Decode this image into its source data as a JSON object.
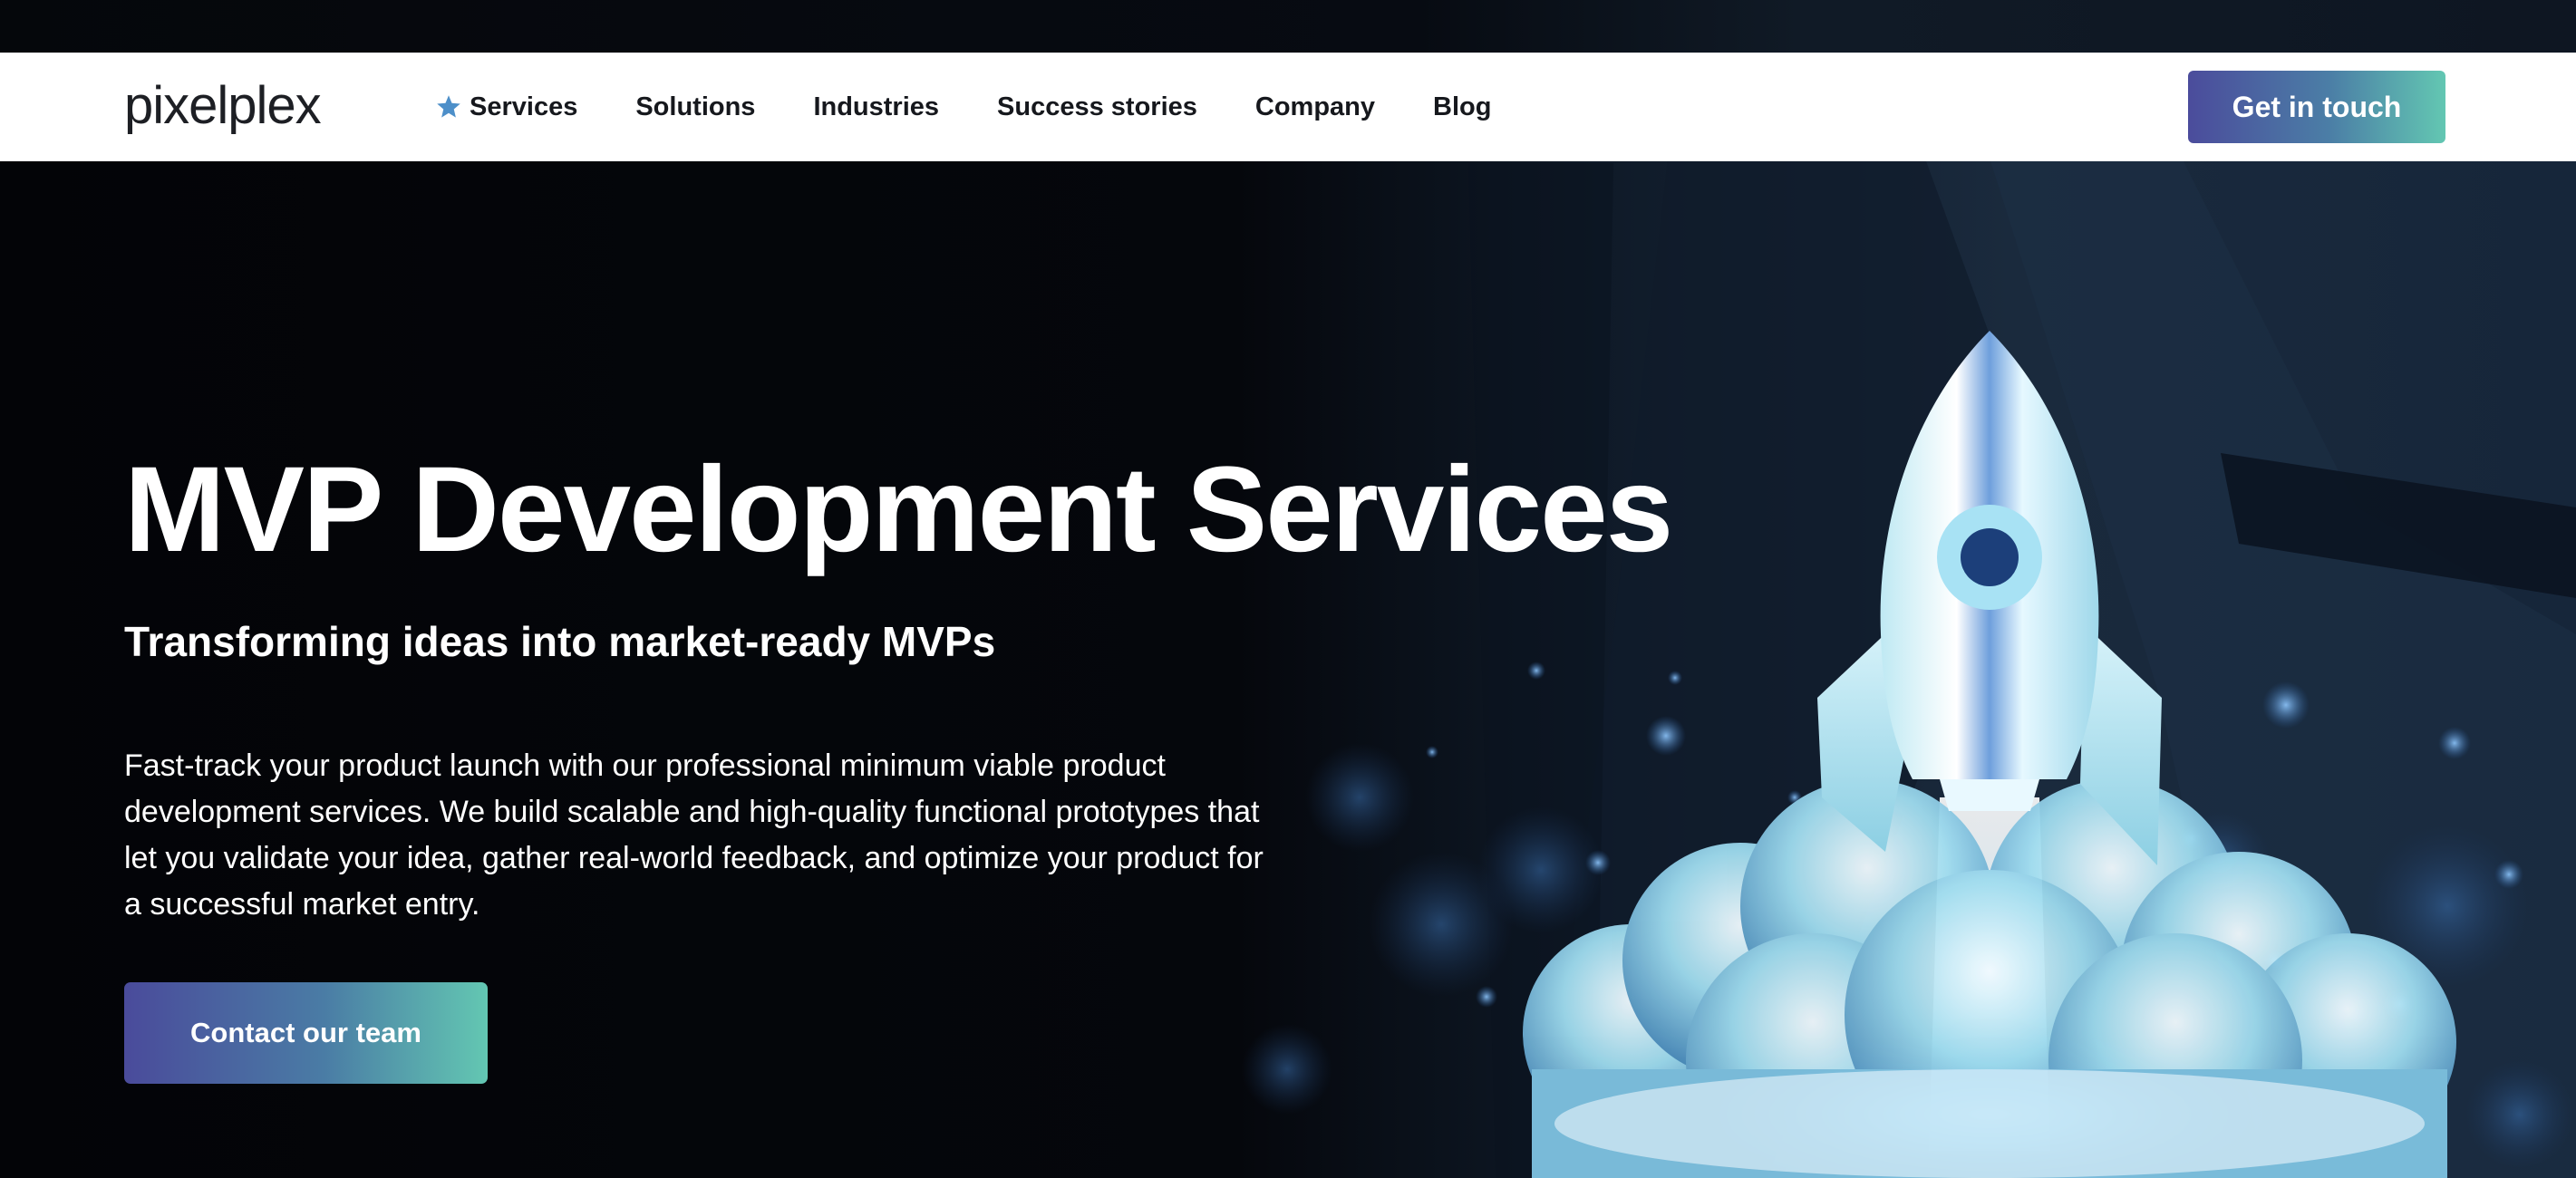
{
  "brand": {
    "logo_text": "pixelplex"
  },
  "nav": {
    "items": [
      {
        "label": "Services",
        "active": true
      },
      {
        "label": "Solutions"
      },
      {
        "label": "Industries"
      },
      {
        "label": "Success stories"
      },
      {
        "label": "Company"
      },
      {
        "label": "Blog"
      }
    ],
    "cta_label": "Get in touch"
  },
  "hero": {
    "title": "MVP Development Services",
    "subtitle": "Transforming ideas into market-ready MVPs",
    "description": "Fast-track your product launch with our professional minimum viable product development services. We build scalable and high-quality functional prototypes that let you validate your idea, gather real-world feedback, and optimize your product for a successful market entry.",
    "cta_label": "Contact our team",
    "illustration": "rocket-launch-illustration"
  },
  "icons": {
    "active_nav_marker": "star-icon"
  },
  "colors": {
    "header_bg": "#ffffff",
    "hero_bg": "#04060a",
    "nav_text": "#16181d",
    "hero_text": "#ffffff",
    "accent_gradient_start": "#4a4b9b",
    "accent_gradient_end": "#63c7b2",
    "star_active": "#4d8fc9",
    "rocket_glow": "#7fd3f5"
  }
}
